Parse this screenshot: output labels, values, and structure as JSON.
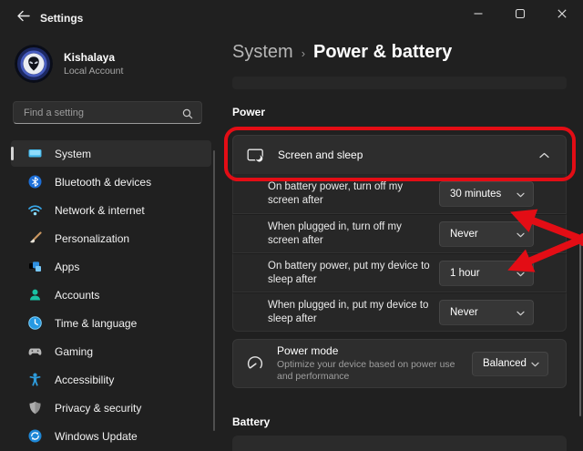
{
  "titlebar": {
    "app_title": "Settings"
  },
  "window_controls": {
    "minimize": "minimize",
    "maximize": "maximize",
    "close": "close"
  },
  "user": {
    "name": "Kishalaya",
    "type": "Local Account"
  },
  "search": {
    "placeholder": "Find a setting"
  },
  "sidebar": {
    "items": [
      {
        "label": "System",
        "icon": "system-icon",
        "selected": true
      },
      {
        "label": "Bluetooth & devices",
        "icon": "bluetooth-icon",
        "selected": false
      },
      {
        "label": "Network & internet",
        "icon": "network-icon",
        "selected": false
      },
      {
        "label": "Personalization",
        "icon": "personalization-icon",
        "selected": false
      },
      {
        "label": "Apps",
        "icon": "apps-icon",
        "selected": false
      },
      {
        "label": "Accounts",
        "icon": "accounts-icon",
        "selected": false
      },
      {
        "label": "Time & language",
        "icon": "time-language-icon",
        "selected": false
      },
      {
        "label": "Gaming",
        "icon": "gaming-icon",
        "selected": false
      },
      {
        "label": "Accessibility",
        "icon": "accessibility-icon",
        "selected": false
      },
      {
        "label": "Privacy & security",
        "icon": "privacy-security-icon",
        "selected": false
      },
      {
        "label": "Windows Update",
        "icon": "windows-update-icon",
        "selected": false
      }
    ]
  },
  "header": {
    "breadcrumb_root": "System",
    "breadcrumb_sep": "›",
    "page_title": "Power & battery"
  },
  "main": {
    "power_heading": "Power",
    "expander": {
      "title": "Screen and sleep",
      "state_icon": "chevron-up"
    },
    "rows": [
      {
        "label": "On battery power, turn off my screen after",
        "value": "30 minutes"
      },
      {
        "label": "When plugged in, turn off my screen after",
        "value": "Never"
      },
      {
        "label": "On battery power, put my device to sleep after",
        "value": "1 hour"
      },
      {
        "label": "When plugged in, put my device to sleep after",
        "value": "Never"
      }
    ],
    "power_mode": {
      "title": "Power mode",
      "subtitle": "Optimize your device based on power use and performance",
      "value": "Balanced"
    },
    "battery_heading": "Battery"
  },
  "icons": {
    "back": "arrow-left",
    "search": "magnifier",
    "dropdown": "chevron-down",
    "expander": "chevron-up"
  },
  "annotation": {
    "color": "#e30d15",
    "highlight": "Screen and sleep section",
    "arrow_targets": [
      "30 minutes",
      "1 hour"
    ]
  }
}
